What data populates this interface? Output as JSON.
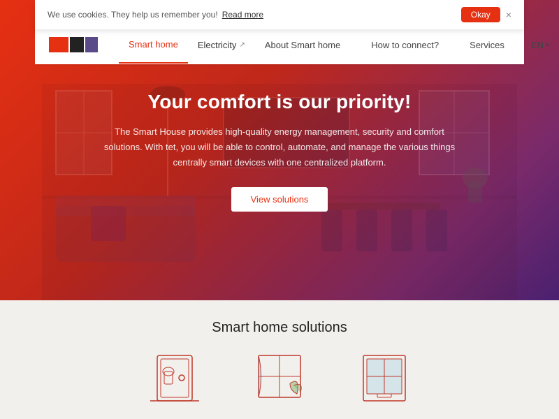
{
  "cookie": {
    "message": "We use cookies. They help us remember you!",
    "link_text": "Read more",
    "ok_label": "Okay",
    "close_label": "×"
  },
  "navbar": {
    "nav_items": [
      {
        "id": "smart-home",
        "label": "Smart home",
        "active": true,
        "external": false
      },
      {
        "id": "electricity",
        "label": "Electricity",
        "active": false,
        "external": true
      }
    ],
    "nav_right": [
      {
        "id": "about",
        "label": "About Smart home"
      },
      {
        "id": "how-to",
        "label": "How to connect?"
      },
      {
        "id": "services",
        "label": "Services"
      }
    ],
    "lang": "EN"
  },
  "hero": {
    "title": "Your comfort is our priority!",
    "subtitle": "The Smart House provides high-quality energy management, security and comfort solutions. With tet, you will be able to control, automate, and manage the various things centrally smart devices with one centralized platform.",
    "btn_label": "View solutions"
  },
  "bottom": {
    "section_title": "Smart home solutions"
  }
}
